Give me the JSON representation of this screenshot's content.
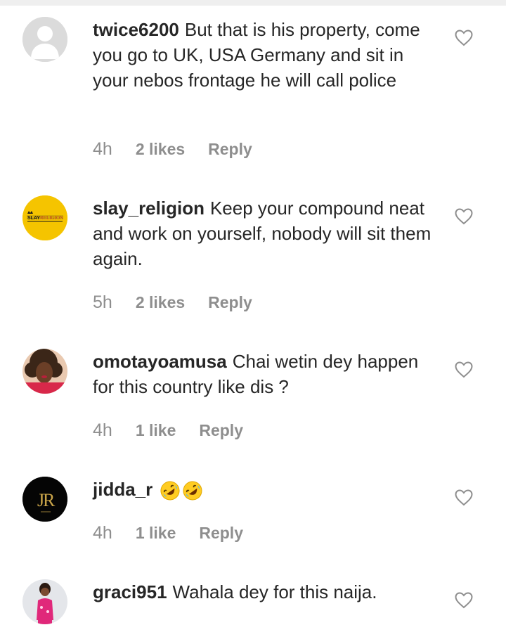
{
  "comments": [
    {
      "username": "twice6200",
      "text": "But that is his property, come you go to UK, USA Germany and sit in your nebos frontage he will call police",
      "time": "4h",
      "likes": "2 likes",
      "reply": "Reply",
      "avatar": "default-avatar"
    },
    {
      "username": "slay_religion",
      "text": "Keep your compound neat and work on yourself, nobody will sit them again.",
      "time": "5h",
      "likes": "2 likes",
      "reply": "Reply",
      "avatar": "slay-religion-logo",
      "avatar_text": "SLAY RELIGION"
    },
    {
      "username": "omotayoamusa",
      "text": "Chai wetin dey happen for this country like dis ?",
      "time": "4h",
      "likes": "1 like",
      "reply": "Reply",
      "avatar": "profile-photo"
    },
    {
      "username": "jidda_r",
      "text": "",
      "emojis": [
        "rolling-on-floor-laughing-emoji",
        "rolling-on-floor-laughing-emoji"
      ],
      "time": "4h",
      "likes": "1 like",
      "reply": "Reply",
      "avatar": "jr-monogram-logo",
      "avatar_text": "JR"
    },
    {
      "username": "graci951",
      "text": "Wahala dey for this naija.",
      "avatar": "profile-photo"
    }
  ],
  "icons": {
    "like": "heart-outline-icon"
  },
  "colors": {
    "text": "#262626",
    "meta": "#8e8e8e",
    "slay_yellow": "#f5c400",
    "jr_gold": "#c9a449"
  }
}
